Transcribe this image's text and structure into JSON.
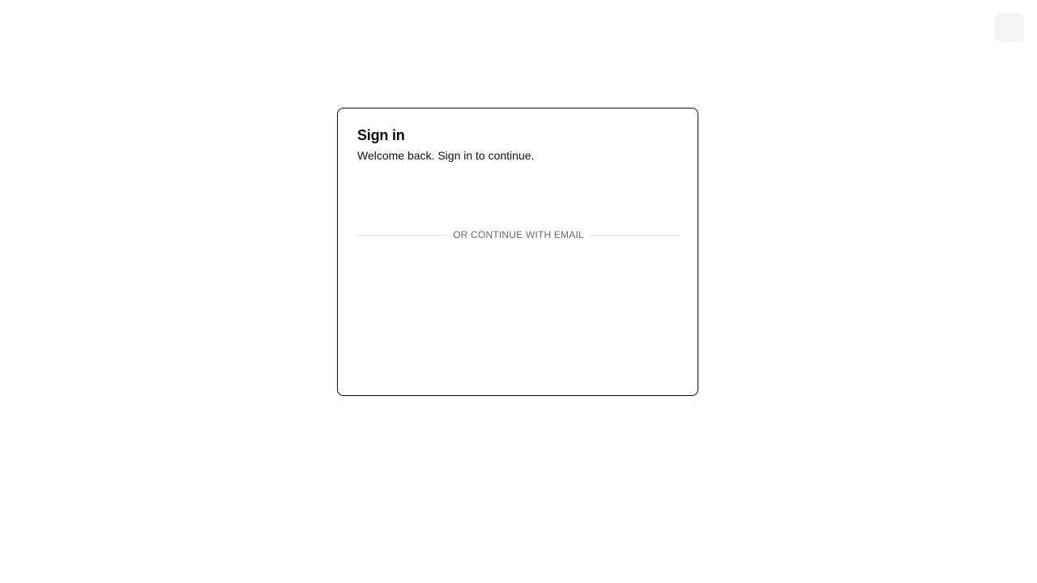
{
  "top_right": {
    "button_label": ""
  },
  "signin_card": {
    "title": "Sign in",
    "subtitle": "Welcome back. Sign in to continue.",
    "divider_text": "OR CONTINUE WITH EMAIL"
  },
  "colors": {
    "background": "#ffffff",
    "card_border": "#111111",
    "divider_line": "#e4e4e7",
    "muted_text": "#6b6b6b",
    "corner_button_bg": "#f4f4f5"
  }
}
